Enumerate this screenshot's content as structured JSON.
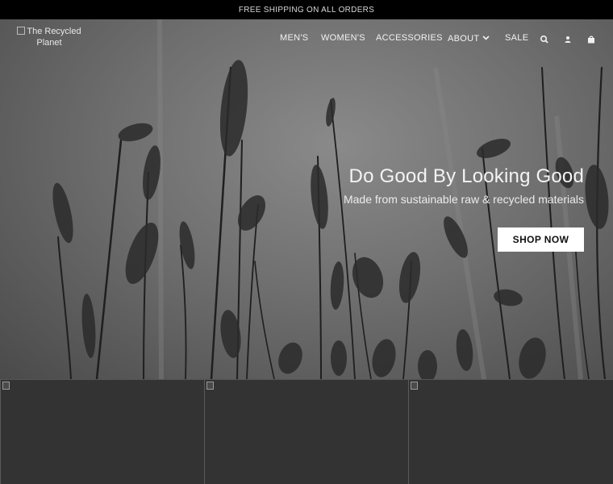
{
  "announcement": "FREE SHIPPING ON ALL ORDERS",
  "header": {
    "logo_alt": "The Recycled Planet",
    "nav": [
      {
        "label": "MEN'S"
      },
      {
        "label": "WOMEN'S"
      },
      {
        "label": "ACCESSORIES"
      },
      {
        "label": "ABOUT"
      },
      {
        "label": "SALE"
      }
    ],
    "icons": [
      "search-icon",
      "account-icon",
      "cart-icon"
    ]
  },
  "hero": {
    "title": "Do Good By Looking Good",
    "subtitle": "Made from sustainable raw & recycled materials",
    "cta": "SHOP NOW"
  },
  "tiles": [
    {
      "name": "collection-tile-1"
    },
    {
      "name": "collection-tile-2"
    },
    {
      "name": "collection-tile-3"
    }
  ]
}
